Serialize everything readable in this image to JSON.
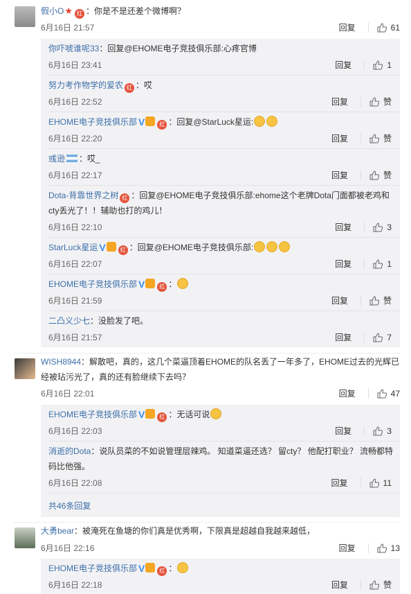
{
  "comments": [
    {
      "user": "假小O",
      "text": "：你是不是还差个微博啊？",
      "date": "6月16日 21:57",
      "reply_label": "回复",
      "likes": "61",
      "replies": [
        {
          "user": "你吓唬谁呢33",
          "text": "：回复@EHOME电子竞技俱乐部:心疼官博",
          "date": "6月16日 23:41",
          "reply_label": "回复",
          "likes": "1"
        },
        {
          "user": "努力考作物学的爱农",
          "text": "：哎",
          "date": "6月16日 22:52",
          "reply_label": "回复",
          "likes": "赞"
        },
        {
          "user": "EHOME电子竞技俱乐部",
          "text": "：回复@StarLuck星运:",
          "date": "6月16日 22:20",
          "reply_label": "回复",
          "likes": "赞"
        },
        {
          "user": "彧逊",
          "text": "：哎_",
          "date": "6月16日 22:17",
          "reply_label": "回复",
          "likes": "赞"
        },
        {
          "user": "Dota-背靠世界之树",
          "text": "：回复@EHOME电子竞技俱乐部:ehome这个老牌Dota门面都被老鸡和cty丢光了！！辅助也打的鸡儿！",
          "date": "6月16日 22:10",
          "reply_label": "回复",
          "likes": "3"
        },
        {
          "user": "StarLuck星运",
          "text": "：回复@EHOME电子竞技俱乐部:",
          "date": "6月16日 22:07",
          "reply_label": "回复",
          "likes": "1"
        },
        {
          "user": "EHOME电子竞技俱乐部",
          "text": "：",
          "date": "6月16日 21:59",
          "reply_label": "回复",
          "likes": "赞"
        },
        {
          "user": "二凸义少七",
          "text": "：没脸发了吧。",
          "date": "6月16日 21:57",
          "reply_label": "回复",
          "likes": "7"
        }
      ]
    },
    {
      "user": "WISH8944",
      "text": "：解散吧，真的，这几个菜逼顶着EHOME的队名丢了一年多了，EHOME过去的光辉已经被玷污光了，真的还有脸继续下去吗？",
      "date": "6月16日 22:01",
      "reply_label": "回复",
      "likes": "47",
      "replies": [
        {
          "user": "EHOME电子竞技俱乐部",
          "text": "：无话可说",
          "date": "6月16日 22:03",
          "reply_label": "回复",
          "likes": "3"
        },
        {
          "user": "消逝的Dota",
          "text": "：说队员菜的不如说管理层辣鸡。  知道菜逼还选？ 留cty？  他配打职业？ 流畅都特码比他强。",
          "date": "6月16日 22:08",
          "reply_label": "回复",
          "likes": "11"
        }
      ],
      "more_replies": "共46条回复"
    },
    {
      "user": "大勇bear",
      "text": "：被淹死在鱼塘的你们真是优秀啊，下限真是超越自我越来越低，",
      "date": "6月16日 22:16",
      "reply_label": "回复",
      "likes": "13",
      "replies": [
        {
          "user": "EHOME电子竞技俱乐部",
          "text": "：",
          "date": "6月16日 22:18",
          "reply_label": "回复",
          "likes": "赞"
        }
      ]
    }
  ],
  "badge_text": "红",
  "vip_mark": "V",
  "colors": {
    "link": "#3d6fa8",
    "reply_bg": "#f2f2f5",
    "badge": "#e5533b",
    "vip": "#3b8ee8"
  }
}
